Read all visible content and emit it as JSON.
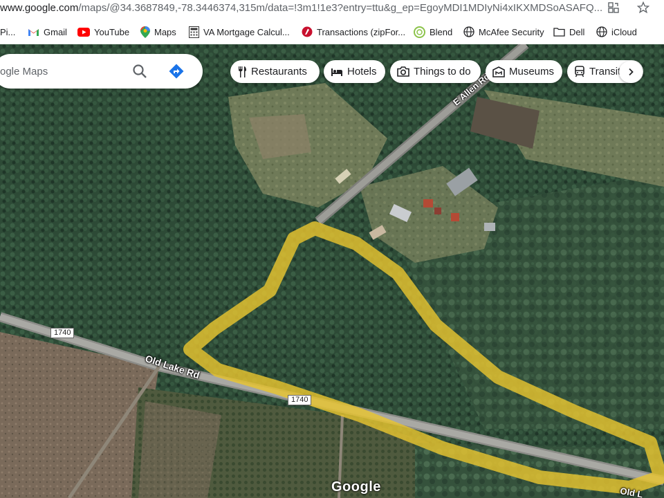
{
  "browser": {
    "url_host": "www.google.com",
    "url_rest": "/maps/@34.3687849,-78.3446374,315m/data=!3m1!1e3?entry=ttu&g_ep=EgoyMDI1MDIyNi4xIKXMDSoASAFQ..."
  },
  "bookmarks": [
    {
      "label": "Pi...",
      "icon": "page-icon"
    },
    {
      "label": "Gmail",
      "icon": "gmail-icon"
    },
    {
      "label": "YouTube",
      "icon": "youtube-icon"
    },
    {
      "label": "Maps",
      "icon": "maps-icon"
    },
    {
      "label": "VA Mortgage Calcul...",
      "icon": "calculator-icon"
    },
    {
      "label": "Transactions (zipFor...",
      "icon": "zipforms-icon"
    },
    {
      "label": "Blend",
      "icon": "blend-icon"
    },
    {
      "label": "McAfee Security",
      "icon": "globe-icon"
    },
    {
      "label": "Dell",
      "icon": "folder-icon"
    },
    {
      "label": "iCloud",
      "icon": "globe-icon"
    }
  ],
  "search": {
    "placeholder": "Search Google Maps",
    "visible_text": "ogle Maps"
  },
  "chips": [
    {
      "label": "Restaurants",
      "icon": "fork-knife-icon"
    },
    {
      "label": "Hotels",
      "icon": "bed-icon"
    },
    {
      "label": "Things to do",
      "icon": "camera-icon"
    },
    {
      "label": "Museums",
      "icon": "museum-icon"
    },
    {
      "label": "Transit",
      "icon": "train-icon"
    }
  ],
  "map": {
    "road_labels": {
      "main_road": "Old Lake Rd",
      "crossing_road": "E Allen Rd",
      "corner_label": "Old L"
    },
    "shields": [
      "1740",
      "1740"
    ],
    "logo": "Google",
    "highlight_color": "#e8c530"
  }
}
